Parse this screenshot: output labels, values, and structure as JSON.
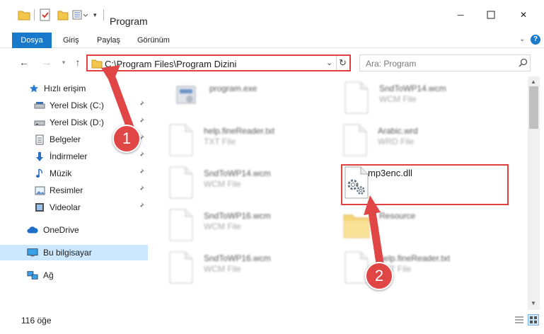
{
  "window": {
    "title": "Program",
    "minimize_glyph": "─",
    "maximize_glyph": "☐",
    "close_glyph": "✕"
  },
  "quick_access": {
    "dropdown_glyph": "▾"
  },
  "ribbon": {
    "tabs": [
      "Dosya",
      "Giriş",
      "Paylaş",
      "Görünüm"
    ],
    "expand_glyph": "⌄",
    "help_glyph": "?"
  },
  "nav": {
    "back_glyph": "←",
    "forward_glyph": "→",
    "recent_glyph": "▾",
    "up_glyph": "↑",
    "address": "C:\\Program Files\\Program Dizini",
    "address_drop_glyph": "⌄",
    "refresh_glyph": "↻",
    "search_placeholder": "Ara: Program"
  },
  "sidebar": {
    "pin_glyph": "📌",
    "items": [
      {
        "label": "Hızlı erişim",
        "icon": "star-icon",
        "pinned": false
      },
      {
        "label": "Yerel Disk (C:)",
        "icon": "drive-icon",
        "pinned": true
      },
      {
        "label": "Yerel Disk (D:)",
        "icon": "drive-icon",
        "pinned": true
      },
      {
        "label": "Belgeler",
        "icon": "document-icon",
        "pinned": true
      },
      {
        "label": "İndirmeler",
        "icon": "download-icon",
        "pinned": true
      },
      {
        "label": "Müzik",
        "icon": "music-icon",
        "pinned": true
      },
      {
        "label": "Resimler",
        "icon": "pictures-icon",
        "pinned": true
      },
      {
        "label": "Videolar",
        "icon": "videos-icon",
        "pinned": true
      },
      {
        "label": "OneDrive",
        "icon": "cloud-icon",
        "pinned": false
      },
      {
        "label": "Bu bilgisayar",
        "icon": "computer-icon",
        "pinned": false,
        "selected": true
      },
      {
        "label": "Ağ",
        "icon": "network-icon",
        "pinned": false
      }
    ]
  },
  "files": [
    {
      "name": "program.exe",
      "type": "",
      "icon": "exe-icon",
      "blurred": true
    },
    {
      "name": "SndToWP14.wcm",
      "type": "WCM File",
      "icon": "file-icon",
      "blurred": true
    },
    {
      "name": "help.fineReader.txt",
      "type": "TXT File",
      "icon": "file-icon",
      "blurred": true
    },
    {
      "name": "Arabic.wrd",
      "type": "WRD File",
      "icon": "file-icon",
      "blurred": true
    },
    {
      "name": "SndToWP14.wcm",
      "type": "WCM File",
      "icon": "file-icon",
      "blurred": true
    },
    {
      "name": "mp3enc.dll",
      "type": "",
      "icon": "dll-gear-icon",
      "blurred": false
    },
    {
      "name": "SndToWP16.wcm",
      "type": "WCM File",
      "icon": "file-icon",
      "blurred": true
    },
    {
      "name": "Resource",
      "type": "",
      "icon": "folder-icon",
      "blurred": true
    },
    {
      "name": "SndToWP16.wcm",
      "type": "WCM File",
      "icon": "file-icon",
      "blurred": true
    },
    {
      "name": "help.fineReader.txt",
      "type": "TXT File",
      "icon": "file-icon",
      "blurred": true
    }
  ],
  "status": {
    "item_count": "116 öğe"
  },
  "scrollbar": {
    "up_glyph": "▲",
    "down_glyph": "▼"
  },
  "annotations": {
    "step1": "1",
    "step2": "2",
    "color": "#e04646"
  }
}
